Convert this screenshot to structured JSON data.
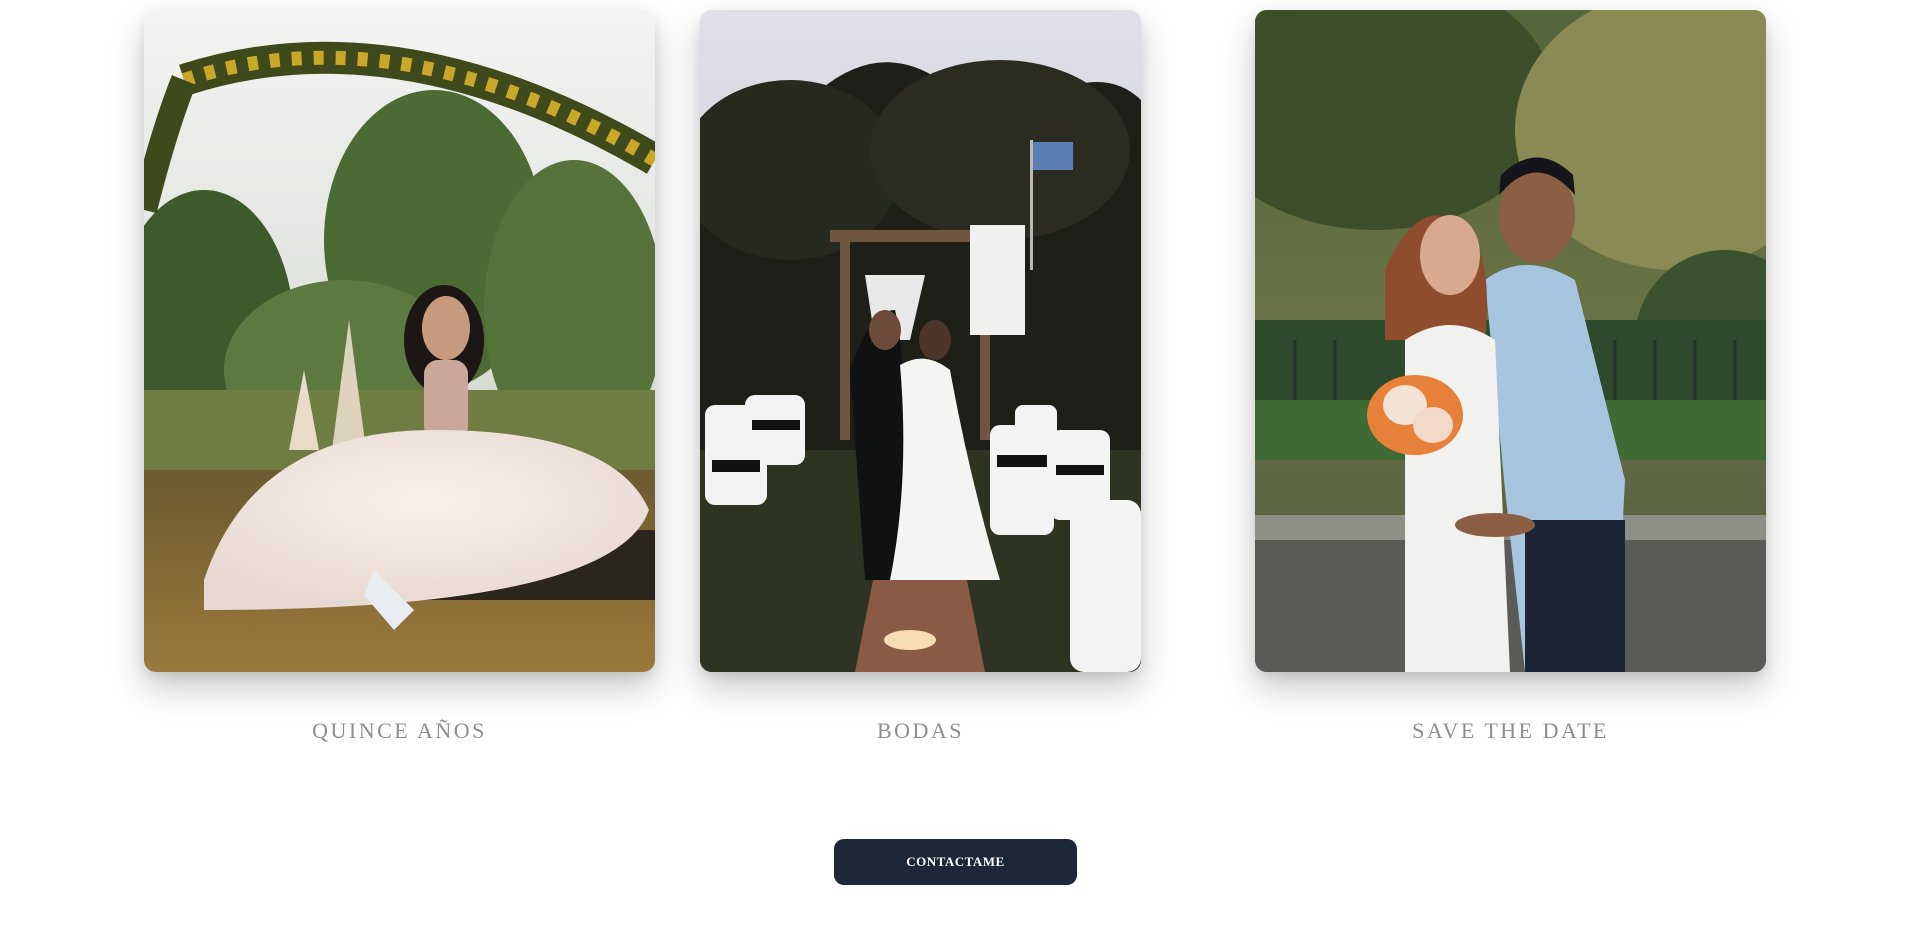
{
  "gallery": {
    "items": [
      {
        "label": "QUINCE AÑOS",
        "photo": "quinceanera-portrait-photo"
      },
      {
        "label": "BODAS",
        "photo": "wedding-kiss-photo"
      },
      {
        "label": "SAVE THE DATE",
        "photo": "couple-embrace-photo"
      }
    ]
  },
  "cta": {
    "label": "CONTACTAME"
  },
  "colors": {
    "caption": "#8e8e8e",
    "button_bg": "#1e2639",
    "button_text": "#ffffff"
  }
}
